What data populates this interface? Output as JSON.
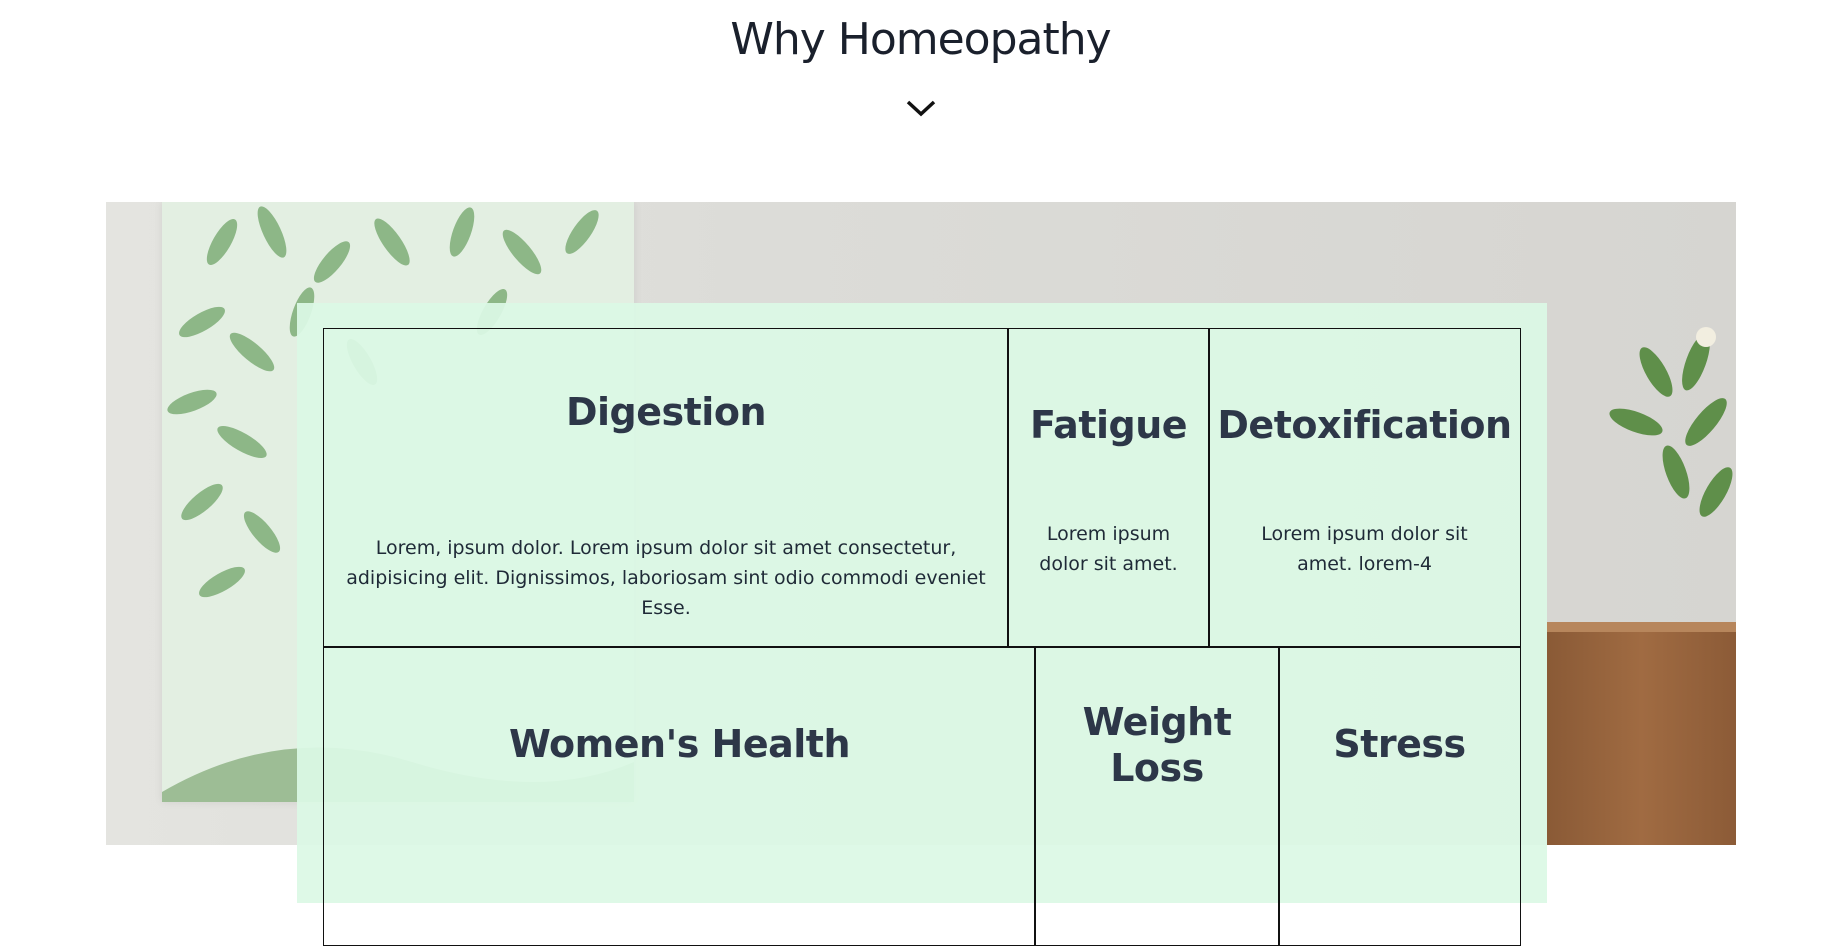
{
  "section": {
    "title": "Why Homeopathy",
    "toggle_icon": "chevron-down-icon"
  },
  "colors": {
    "panel": "#dcf9e5",
    "heading": "#2d3748",
    "border": "#111111"
  },
  "cards": [
    {
      "title": "Digestion",
      "text": "Lorem, ipsum dolor. Lorem ipsum dolor sit amet consectetur, adipisicing elit. Dignissimos, laboriosam sint odio commodi eveniet Esse."
    },
    {
      "title": "Fatigue",
      "text": "Lorem ipsum dolor sit amet."
    },
    {
      "title": "Detoxification",
      "text": "Lorem ipsum dolor sit amet. lorem-4"
    },
    {
      "title": "Women's Health"
    },
    {
      "title": "Weight Loss"
    },
    {
      "title": "Stress"
    }
  ]
}
